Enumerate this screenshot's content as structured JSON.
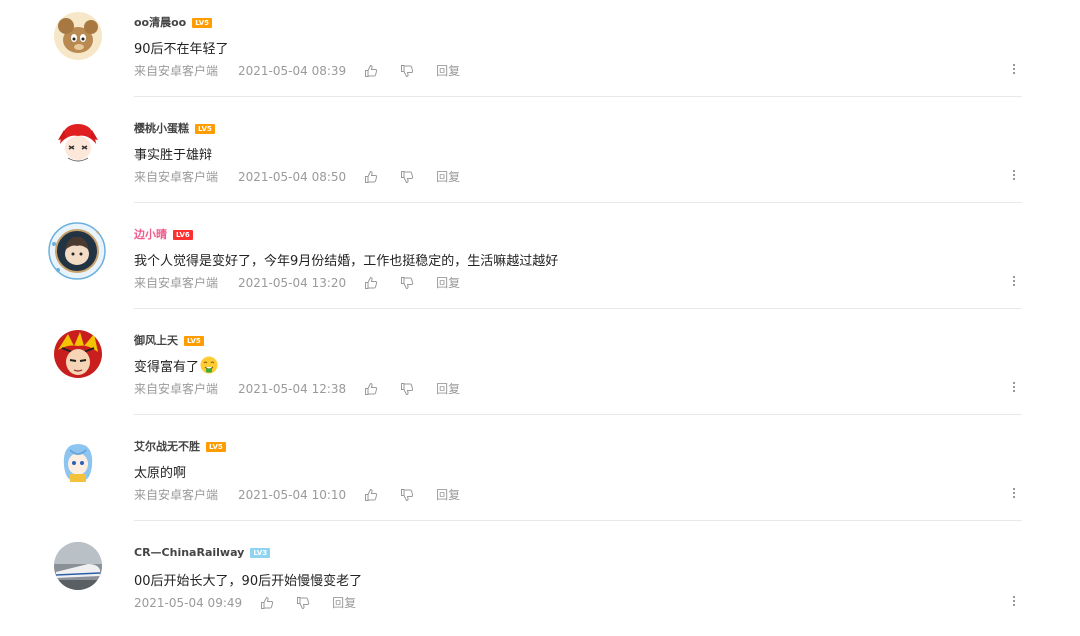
{
  "comments": [
    {
      "username": "oo清晨oo",
      "level": "LV5",
      "text": "90后不在年轻了",
      "source": "来自安卓客户端",
      "time": "2021-05-04 08:39",
      "reply": "回复"
    },
    {
      "username": "樱桃小蛋糕",
      "level": "LV5",
      "text": "事实胜于雄辩",
      "source": "来自安卓客户端",
      "time": "2021-05-04 08:50",
      "reply": "回复"
    },
    {
      "username": "边小晴",
      "level": "LV6",
      "text": "我个人觉得是变好了，今年9月份结婚，工作也挺稳定的，生活嘛越过越好",
      "source": "来自安卓客户端",
      "time": "2021-05-04 13:20",
      "reply": "回复"
    },
    {
      "username": "御风上天",
      "level": "LV5",
      "text": "变得富有了",
      "source": "来自安卓客户端",
      "time": "2021-05-04 12:38",
      "reply": "回复"
    },
    {
      "username": "艾尔战无不胜",
      "level": "LV5",
      "text": "太原的啊",
      "source": "来自安卓客户端",
      "time": "2021-05-04 10:10",
      "reply": "回复"
    },
    {
      "username": "CR—ChinaRailway",
      "level": "LV3",
      "text": "00后开始长大了，90后开始慢慢变老了",
      "time": "2021-05-04 09:49",
      "reply": "回复"
    }
  ],
  "icons": {
    "like": "thumbs-up-icon",
    "dislike": "thumbs-down-icon",
    "more": "more-vertical-icon",
    "emoji": "money-face-emoji"
  },
  "colors": {
    "vip_name": "#f05a8a",
    "lv5": "#ff9c00",
    "lv6": "#ff3030",
    "lv3": "#8fd3f0",
    "meta": "#9a9a9a"
  }
}
